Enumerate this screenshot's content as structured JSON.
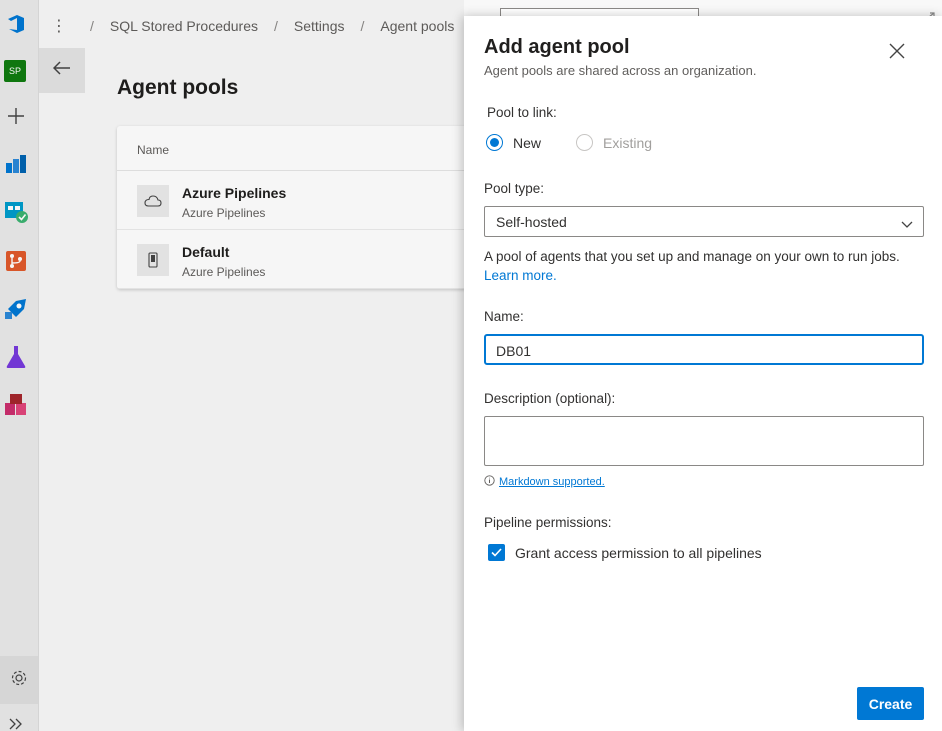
{
  "breadcrumb": {
    "project": "SQL Stored Procedures",
    "settings": "Settings",
    "current": "Agent pools"
  },
  "avatar": {
    "initials": "SP",
    "color": "#107c10"
  },
  "page": {
    "title": "Agent pools",
    "table": {
      "column_header": "Name",
      "rows": [
        {
          "name": "Azure Pipelines",
          "subtitle": "Azure Pipelines",
          "icon": "cloud-icon"
        },
        {
          "name": "Default",
          "subtitle": "Azure Pipelines",
          "icon": "device-icon"
        }
      ]
    }
  },
  "panel": {
    "title": "Add agent pool",
    "subtitle": "Agent pools are shared across an organization.",
    "pool_to_link_label": "Pool to link:",
    "radio_new": "New",
    "radio_existing": "Existing",
    "pool_type_label": "Pool type:",
    "pool_type_value": "Self-hosted",
    "help_text": "A pool of agents that you set up and manage on your own to run jobs.",
    "learn_more": "Learn more.",
    "name_label": "Name:",
    "name_value": "DB01",
    "description_label": "Description (optional):",
    "description_value": "",
    "markdown_link": "Markdown supported.",
    "pipeline_permissions_label": "Pipeline permissions:",
    "grant_access_label": "Grant access permission to all pipelines",
    "create_button": "Create"
  },
  "colors": {
    "accent": "#0078d4",
    "pipelines_icon": "#0078d4",
    "boards_icon": "#009ccc",
    "repos_icon": "#e05a2b",
    "test_plans_icon": "#773adc",
    "artifacts_icon": "#cb2e6d"
  }
}
